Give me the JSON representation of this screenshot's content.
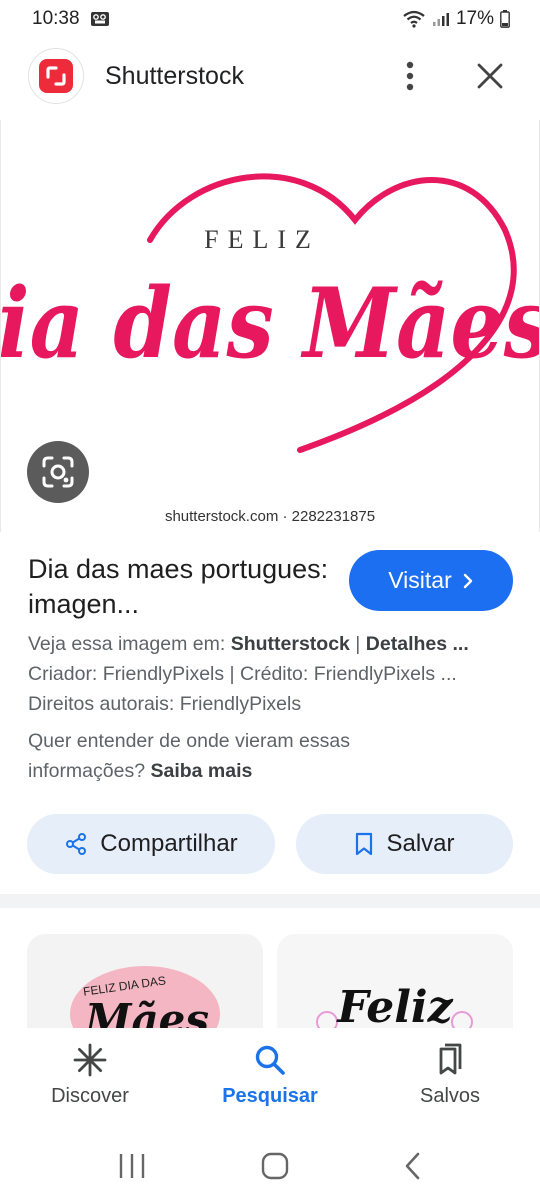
{
  "status_bar": {
    "time": "10:38",
    "battery": "17%"
  },
  "header": {
    "site_name": "Shutterstock",
    "logo_color": "#ee2b3b"
  },
  "hero": {
    "image_text_top": "FELIZ",
    "image_text_main": "Dia das Mães",
    "watermark": "shutterstock.com · 2282231875",
    "accent_color": "#e8185e"
  },
  "result": {
    "title": "Dia das maes portugues: imagen...",
    "visit_label": "Visitar",
    "view_prefix": "Veja essa imagem em: ",
    "view_source": "Shutterstock",
    "view_sep": " | ",
    "details_label": "Detalhes ...",
    "creator_line": "Criador: FriendlyPixels | Crédito: FriendlyPixels ...",
    "copyright_line": "Direitos autorais: FriendlyPixels",
    "info_line_1": "Quer entender de onde vieram essas",
    "info_line_2_prefix": "informações? ",
    "learn_more": "Saiba mais"
  },
  "actions": {
    "share_label": "Compartilhar",
    "save_label": "Salvar"
  },
  "related": {
    "card1_text_top": "FELIZ DIA DAS",
    "card1_text_main": "Mães",
    "card2_text": "Feliz"
  },
  "bottom_nav": {
    "items": [
      {
        "label": "Discover",
        "icon": "asterisk-icon"
      },
      {
        "label": "Pesquisar",
        "icon": "search-icon",
        "active": true
      },
      {
        "label": "Salvos",
        "icon": "bookmarks-icon"
      }
    ],
    "active_color": "#1a73e8"
  }
}
